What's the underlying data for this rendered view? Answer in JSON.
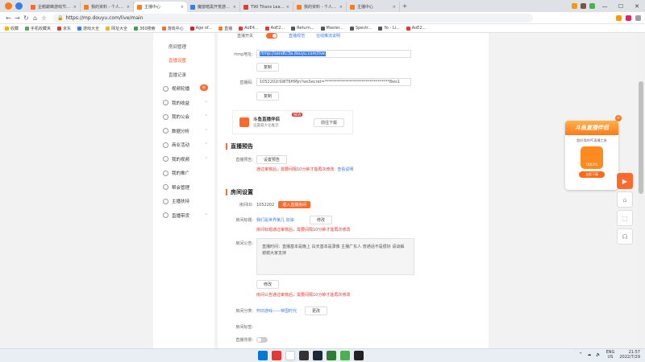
{
  "browser": {
    "tabs": [
      {
        "title": "企鹅巅峰游戏节_斗鱼直播平台",
        "color": "#ff6a2c",
        "active": false
      },
      {
        "title": "我的资料 - 个人中心 - 斗鱼",
        "color": "#ff7a1a",
        "active": false
      },
      {
        "title": "主播中心",
        "color": "#ff7a1a",
        "active": true
      },
      {
        "title": "魔兽暗黑开荒游戏直播 资源汇",
        "color": "#3a7ce8",
        "active": false
      },
      {
        "title": "T90 Titans League: Gold Lo",
        "color": "#e03b2e",
        "active": false
      },
      {
        "title": "我的资料 - 个人中心 - 斗鱼",
        "color": "#ff7a1a",
        "active": false
      },
      {
        "title": "主播中心",
        "color": "#ff7a1a",
        "active": false
      }
    ],
    "url": "https://mp.douyu.com/live/main",
    "bookmarks": [
      {
        "label": "收藏",
        "color": "#f5b400"
      },
      {
        "label": "手机收藏夹",
        "color": "#4caf50"
      },
      {
        "label": "京东",
        "color": "#e03b2e"
      },
      {
        "label": "游戏大全",
        "color": "#3a7ce8"
      },
      {
        "label": "网址大全",
        "color": "#ffb300"
      },
      {
        "label": "360搜索",
        "color": "#43a047"
      },
      {
        "label": "游戏中心",
        "color": "#ff6a2c"
      },
      {
        "label": "Age of...",
        "color": "#c62828"
      },
      {
        "label": "直播",
        "color": "#ff7a1a"
      },
      {
        "label": "AoE4...",
        "color": "#e53935"
      },
      {
        "label": "AoE2...",
        "color": "#e53935"
      },
      {
        "label": "Return...",
        "color": "#555555"
      },
      {
        "label": "Master...",
        "color": "#555555"
      },
      {
        "label": "Spectr...",
        "color": "#555555"
      },
      {
        "label": "Yo - Li...",
        "color": "#555555"
      },
      {
        "label": "AoE2...",
        "color": "#e53935"
      }
    ]
  },
  "sidebar": {
    "items": [
      {
        "label": "房间管理",
        "sub": true,
        "active": false
      },
      {
        "label": "直播设置",
        "sub": true,
        "active": true
      },
      {
        "label": "直播记录",
        "sub": true,
        "active": false
      },
      {
        "label": "视频轮播",
        "sub": false,
        "chev": false,
        "badge": "新"
      },
      {
        "label": "我的收益",
        "sub": false,
        "chev": true
      },
      {
        "label": "我的公会",
        "sub": false,
        "chev": true
      },
      {
        "label": "数据分析",
        "sub": false,
        "chev": true
      },
      {
        "label": "商业活动",
        "sub": false,
        "chev": true
      },
      {
        "label": "我的视频",
        "sub": false,
        "chev": true
      },
      {
        "label": "我的推广",
        "sub": false,
        "chev": false
      },
      {
        "label": "帮会管理",
        "sub": false,
        "chev": false
      },
      {
        "label": "主播扶持",
        "sub": false,
        "chev": false
      },
      {
        "label": "直播带货",
        "sub": false,
        "chev": true
      }
    ]
  },
  "main": {
    "top_row": {
      "label": "直播开关",
      "link1": "直播规范",
      "link2": "在线推流说明"
    },
    "rtmp": {
      "label": "rtmp地址:",
      "value": "rtmp://sendtc3a.douyu.com/live",
      "copy": "复制"
    },
    "stream_key": {
      "label": "直播码:",
      "value": "1052202rSWT6HMjn?wsSecret=********************************8ws1",
      "copy": "复制"
    },
    "promo": {
      "title": "斗鱼直播伴侣",
      "badge": "NEW",
      "desc": "设置最大化推流",
      "button": "前往下载"
    },
    "preview": {
      "section": "直播预告",
      "label": "直播预告:",
      "button": "设置预告",
      "warn": "通过审核后，需要间隔10分钟才能再次修改",
      "link": "查看说明"
    },
    "room": {
      "section": "房间设置",
      "id_label": "房间ID:",
      "id_value": "1052202",
      "join_btn": "进入直播房间",
      "title_label": "房间标题:",
      "title_value": "我们是世界第几 加油",
      "title_btn": "修改",
      "title_warn": "房间标题通过审核后，需要间隔10分钟才能再次修改",
      "notice_label": "房间公告:",
      "notice_text": "直播时间：直播基本是晚上 白天基本是录像 主播广东人 普通话不是很好 请谅解 谢谢大家支持",
      "notice_btn": "修改",
      "notice_warn": "房间公告通过审核后，需要间隔10分钟才能再次修改",
      "category_label": "房间分类:",
      "category_value": "怀旧游戏——帝国时代",
      "category_btn": "更改",
      "tag_label": "房间标签:",
      "bg_label": "直播背景:"
    }
  },
  "ad": {
    "title": "斗鱼直播伴侣",
    "desc": "超好用的PC直播工具",
    "logo_text": "DOUYU",
    "button": "立即下载"
  },
  "taskbar": {
    "apps": [
      "#0078d4",
      "#e53935",
      "#ffffff",
      "#333333",
      "#1b2838",
      "#2e7d32",
      "#4caf50",
      "#222222"
    ],
    "lang_top": "ENG",
    "lang_bottom": "US",
    "time": "21:57",
    "date": "2022/7/29"
  }
}
